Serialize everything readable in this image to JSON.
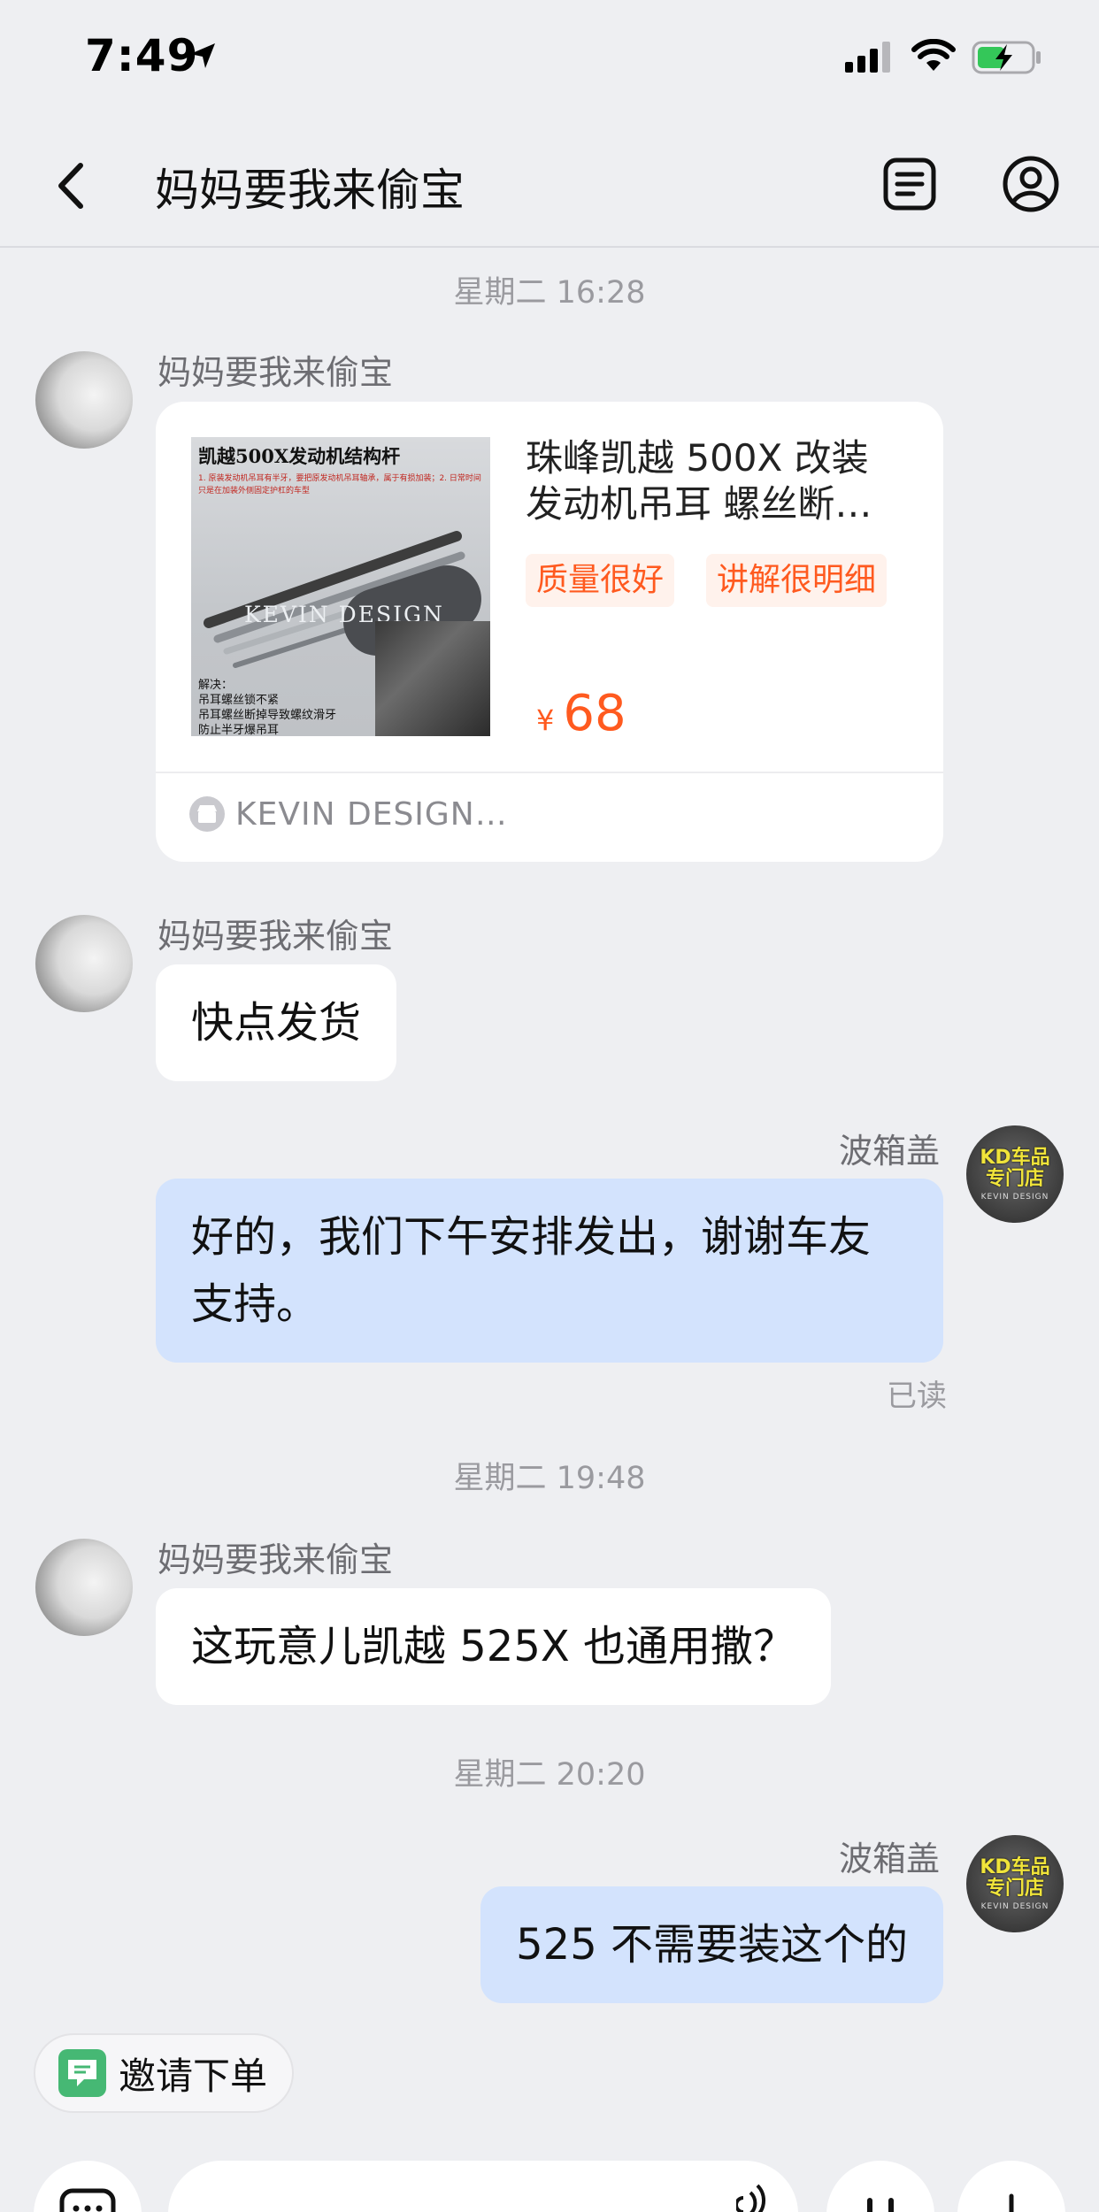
{
  "status_bar": {
    "time": "7:49"
  },
  "nav": {
    "title": "妈妈要我来偷宝"
  },
  "messages": {
    "sep1": "星期二 16:28",
    "buyer_name": "妈妈要我来偷宝",
    "seller_name": "波箱盖",
    "product": {
      "image_title": "凯越500X发动机结构杆",
      "image_note": "1. 原装发动机吊耳有半牙，要把原发动机吊耳轴承，属于有损加装；2. 日常时间只是在加装外侧固定护杠的车型",
      "image_footer_1": "解决：",
      "image_footer_2": "吊耳螺丝锁不紧",
      "image_footer_3": "吊耳螺丝断掉导致螺纹滑牙",
      "image_footer_4": "防止半牙爆吊耳",
      "image_brand": "KEVIN DESIGN",
      "title_line1": "珠峰凯越 500X 改装",
      "title_line2": "发动机吊耳 螺丝断…",
      "tag1": "质量很好",
      "tag2": "讲解很明细",
      "currency": "¥",
      "price": "68",
      "shop": "KEVIN DESIGN…"
    },
    "msg_buyer_1": "快点发货",
    "msg_seller_1": "好的，我们下午安排发出，谢谢车友支持。",
    "read_status": "已读",
    "sep2": "星期二 19:48",
    "msg_buyer_2": "这玩意儿凯越 525X 也通用撒？",
    "sep3": "星期二 20:20",
    "msg_seller_2": "525 不需要装这个的"
  },
  "avatar_seller": {
    "line1": "KD车品",
    "line2": "专门店",
    "sub": "KEVIN DESIGN"
  },
  "bottom": {
    "invite_label": "邀请下单"
  },
  "colors": {
    "accent": "#ff5a1f",
    "bubble_out": "#d3e3fd",
    "background": "#eeeff2",
    "invite": "#46b874"
  },
  "icons": [
    "location-arrow-icon",
    "signal-icon",
    "wifi-icon",
    "battery-charging-icon",
    "back-chevron-icon",
    "order-list-icon",
    "profile-icon",
    "shop-icon",
    "invite-order-icon",
    "voice-icon"
  ]
}
